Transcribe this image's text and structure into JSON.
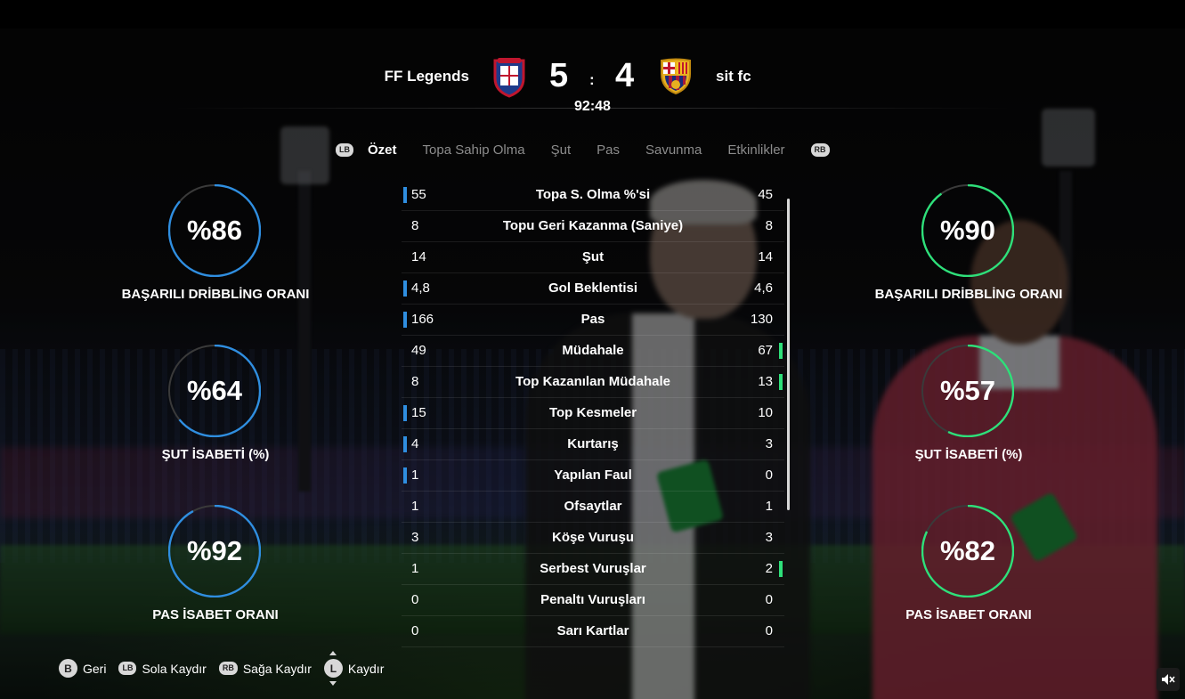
{
  "match": {
    "home_team": "FF Legends",
    "away_team": "sit fc",
    "home_score": "5",
    "away_score": "4",
    "score_separator": ":",
    "clock": "92:48"
  },
  "tabs": {
    "left_bumper": "LB",
    "right_bumper": "RB",
    "items": [
      "Özet",
      "Topa Sahip Olma",
      "Şut",
      "Pas",
      "Savunma",
      "Etkinlikler"
    ],
    "active": "Özet"
  },
  "left_circles": [
    {
      "value": "%86",
      "label": "BAŞARILI DRİBBLİNG ORANI",
      "fill": 0.86
    },
    {
      "value": "%64",
      "label": "ŞUT İSABETİ (%)",
      "fill": 0.64
    },
    {
      "value": "%92",
      "label": "PAS İSABET ORANI",
      "fill": 0.92
    }
  ],
  "right_circles": [
    {
      "value": "%90",
      "label": "BAŞARILI DRİBBLİNG ORANI",
      "fill": 0.9
    },
    {
      "value": "%57",
      "label": "ŞUT İSABETİ (%)",
      "fill": 0.57
    },
    {
      "value": "%82",
      "label": "PAS İSABET ORANI",
      "fill": 0.82
    }
  ],
  "stats": [
    {
      "home": "55",
      "name": "Topa S. Olma %'si",
      "away": "45",
      "leader": "home"
    },
    {
      "home": "8",
      "name": "Topu Geri Kazanma (Saniye)",
      "away": "8",
      "leader": "none"
    },
    {
      "home": "14",
      "name": "Şut",
      "away": "14",
      "leader": "none"
    },
    {
      "home": "4,8",
      "name": "Gol Beklentisi",
      "away": "4,6",
      "leader": "home"
    },
    {
      "home": "166",
      "name": "Pas",
      "away": "130",
      "leader": "home"
    },
    {
      "home": "49",
      "name": "Müdahale",
      "away": "67",
      "leader": "away"
    },
    {
      "home": "8",
      "name": "Top Kazanılan Müdahale",
      "away": "13",
      "leader": "away"
    },
    {
      "home": "15",
      "name": "Top Kesmeler",
      "away": "10",
      "leader": "home"
    },
    {
      "home": "4",
      "name": "Kurtarış",
      "away": "3",
      "leader": "home"
    },
    {
      "home": "1",
      "name": "Yapılan Faul",
      "away": "0",
      "leader": "home"
    },
    {
      "home": "1",
      "name": "Ofsaytlar",
      "away": "1",
      "leader": "none"
    },
    {
      "home": "3",
      "name": "Köşe Vuruşu",
      "away": "3",
      "leader": "none"
    },
    {
      "home": "1",
      "name": "Serbest Vuruşlar",
      "away": "2",
      "leader": "away"
    },
    {
      "home": "0",
      "name": "Penaltı Vuruşları",
      "away": "0",
      "leader": "none"
    },
    {
      "home": "0",
      "name": "Sarı Kartlar",
      "away": "0",
      "leader": "none"
    }
  ],
  "hints": [
    {
      "key": "B",
      "label": "Geri"
    },
    {
      "key": "LB",
      "label": "Sola Kaydır"
    },
    {
      "key": "RB",
      "label": "Sağa Kaydır"
    },
    {
      "key": "L",
      "label": "Kaydır"
    }
  ],
  "colors": {
    "home_accent": "#2f8ee0",
    "away_accent": "#2ee07a",
    "ring_track": "#3a3a3a"
  },
  "icons": {
    "home_crest": "cagliari-crest-icon",
    "away_crest": "barcelona-crest-icon",
    "mute": "speaker-muted-icon"
  }
}
